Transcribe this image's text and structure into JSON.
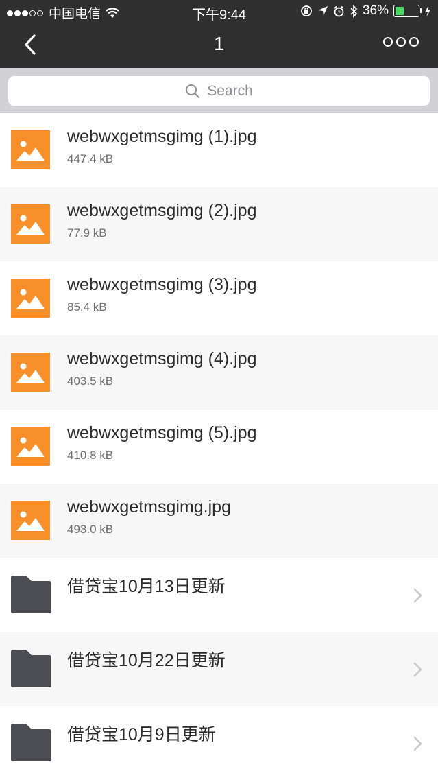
{
  "status_bar": {
    "carrier": "中国电信",
    "time": "下午9:44",
    "battery_percent": "36%",
    "battery_level": 0.36
  },
  "nav": {
    "title": "1"
  },
  "search": {
    "placeholder": "Search"
  },
  "files": [
    {
      "name": "webwxgetmsgimg (1).jpg",
      "size": "447.4 kB"
    },
    {
      "name": "webwxgetmsgimg (2).jpg",
      "size": "77.9 kB"
    },
    {
      "name": "webwxgetmsgimg (3).jpg",
      "size": "85.4 kB"
    },
    {
      "name": "webwxgetmsgimg (4).jpg",
      "size": "403.5 kB"
    },
    {
      "name": "webwxgetmsgimg (5).jpg",
      "size": "410.8 kB"
    },
    {
      "name": "webwxgetmsgimg.jpg",
      "size": "493.0 kB"
    }
  ],
  "folders": [
    {
      "name": "借贷宝10月13日更新"
    },
    {
      "name": "借贷宝10月22日更新"
    },
    {
      "name": "借贷宝10月9日更新"
    }
  ],
  "colors": {
    "image_icon": "#f7902a",
    "folder_icon": "#4b4d52",
    "header_bg": "#2f2f2f"
  }
}
